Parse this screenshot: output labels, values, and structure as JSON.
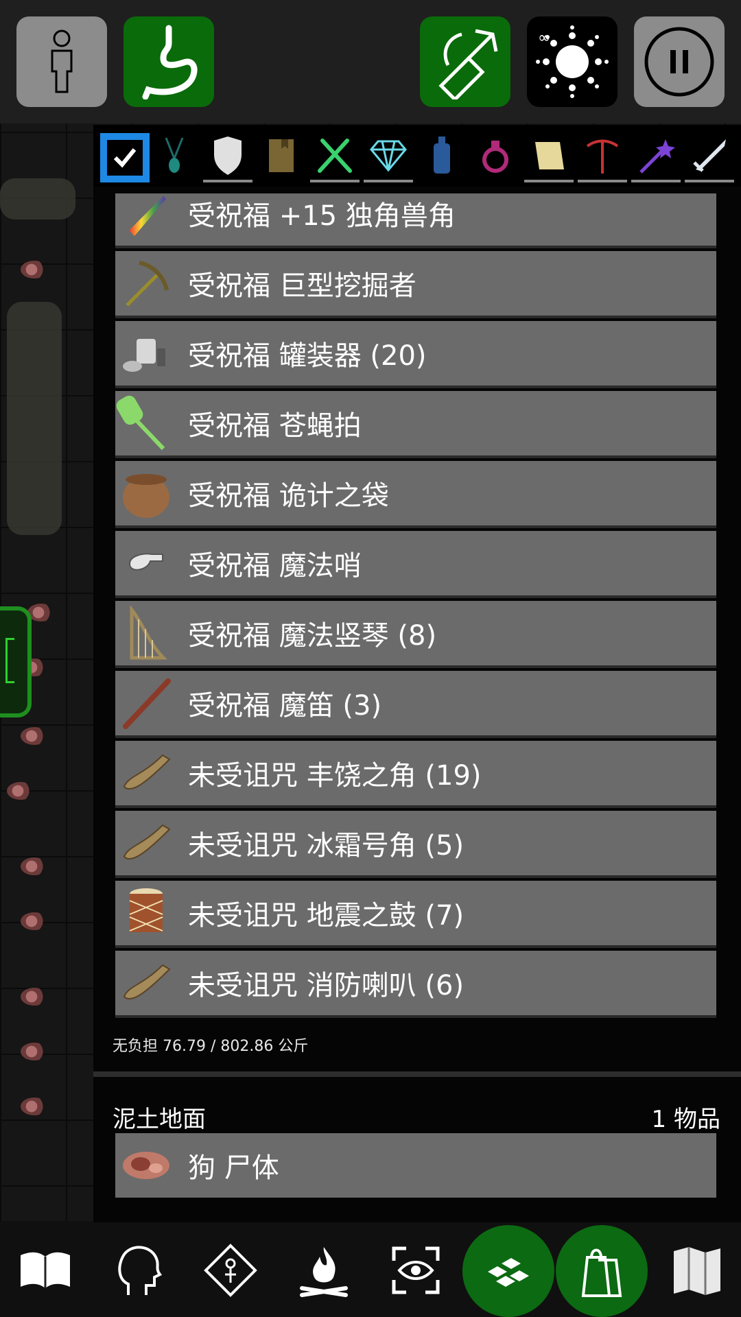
{
  "inventory": {
    "items": [
      {
        "label": "受祝福 +15 独角兽角",
        "icon": "unicorn-horn-icon"
      },
      {
        "label": "受祝福 巨型挖掘者",
        "icon": "pickaxe-icon"
      },
      {
        "label": "受祝福 罐装器 (20)",
        "icon": "tinning-kit-icon"
      },
      {
        "label": "受祝福 苍蝇拍",
        "icon": "flyswatter-icon"
      },
      {
        "label": "受祝福 诡计之袋",
        "icon": "bag-icon"
      },
      {
        "label": "受祝福 魔法哨",
        "icon": "whistle-icon"
      },
      {
        "label": "受祝福 魔法竖琴 (8)",
        "icon": "harp-icon"
      },
      {
        "label": "受祝福 魔笛 (3)",
        "icon": "flute-icon"
      },
      {
        "label": "未受诅咒 丰饶之角 (19)",
        "icon": "horn-icon"
      },
      {
        "label": "未受诅咒 冰霜号角 (5)",
        "icon": "horn-icon"
      },
      {
        "label": "未受诅咒 地震之鼓 (7)",
        "icon": "drum-icon"
      },
      {
        "label": "未受诅咒 消防喇叭 (6)",
        "icon": "horn-icon"
      }
    ],
    "weight_text": "无负担 76.79 / 802.86 公斤"
  },
  "floor": {
    "title": "泥土地面",
    "count": "1 物品",
    "items": [
      {
        "label": "狗 尸体",
        "icon": "corpse-icon"
      }
    ]
  },
  "colors": {
    "accent_blue": "#1e88e5",
    "button_green": "#0a6b0a",
    "item_gray": "#6b6b6b"
  }
}
